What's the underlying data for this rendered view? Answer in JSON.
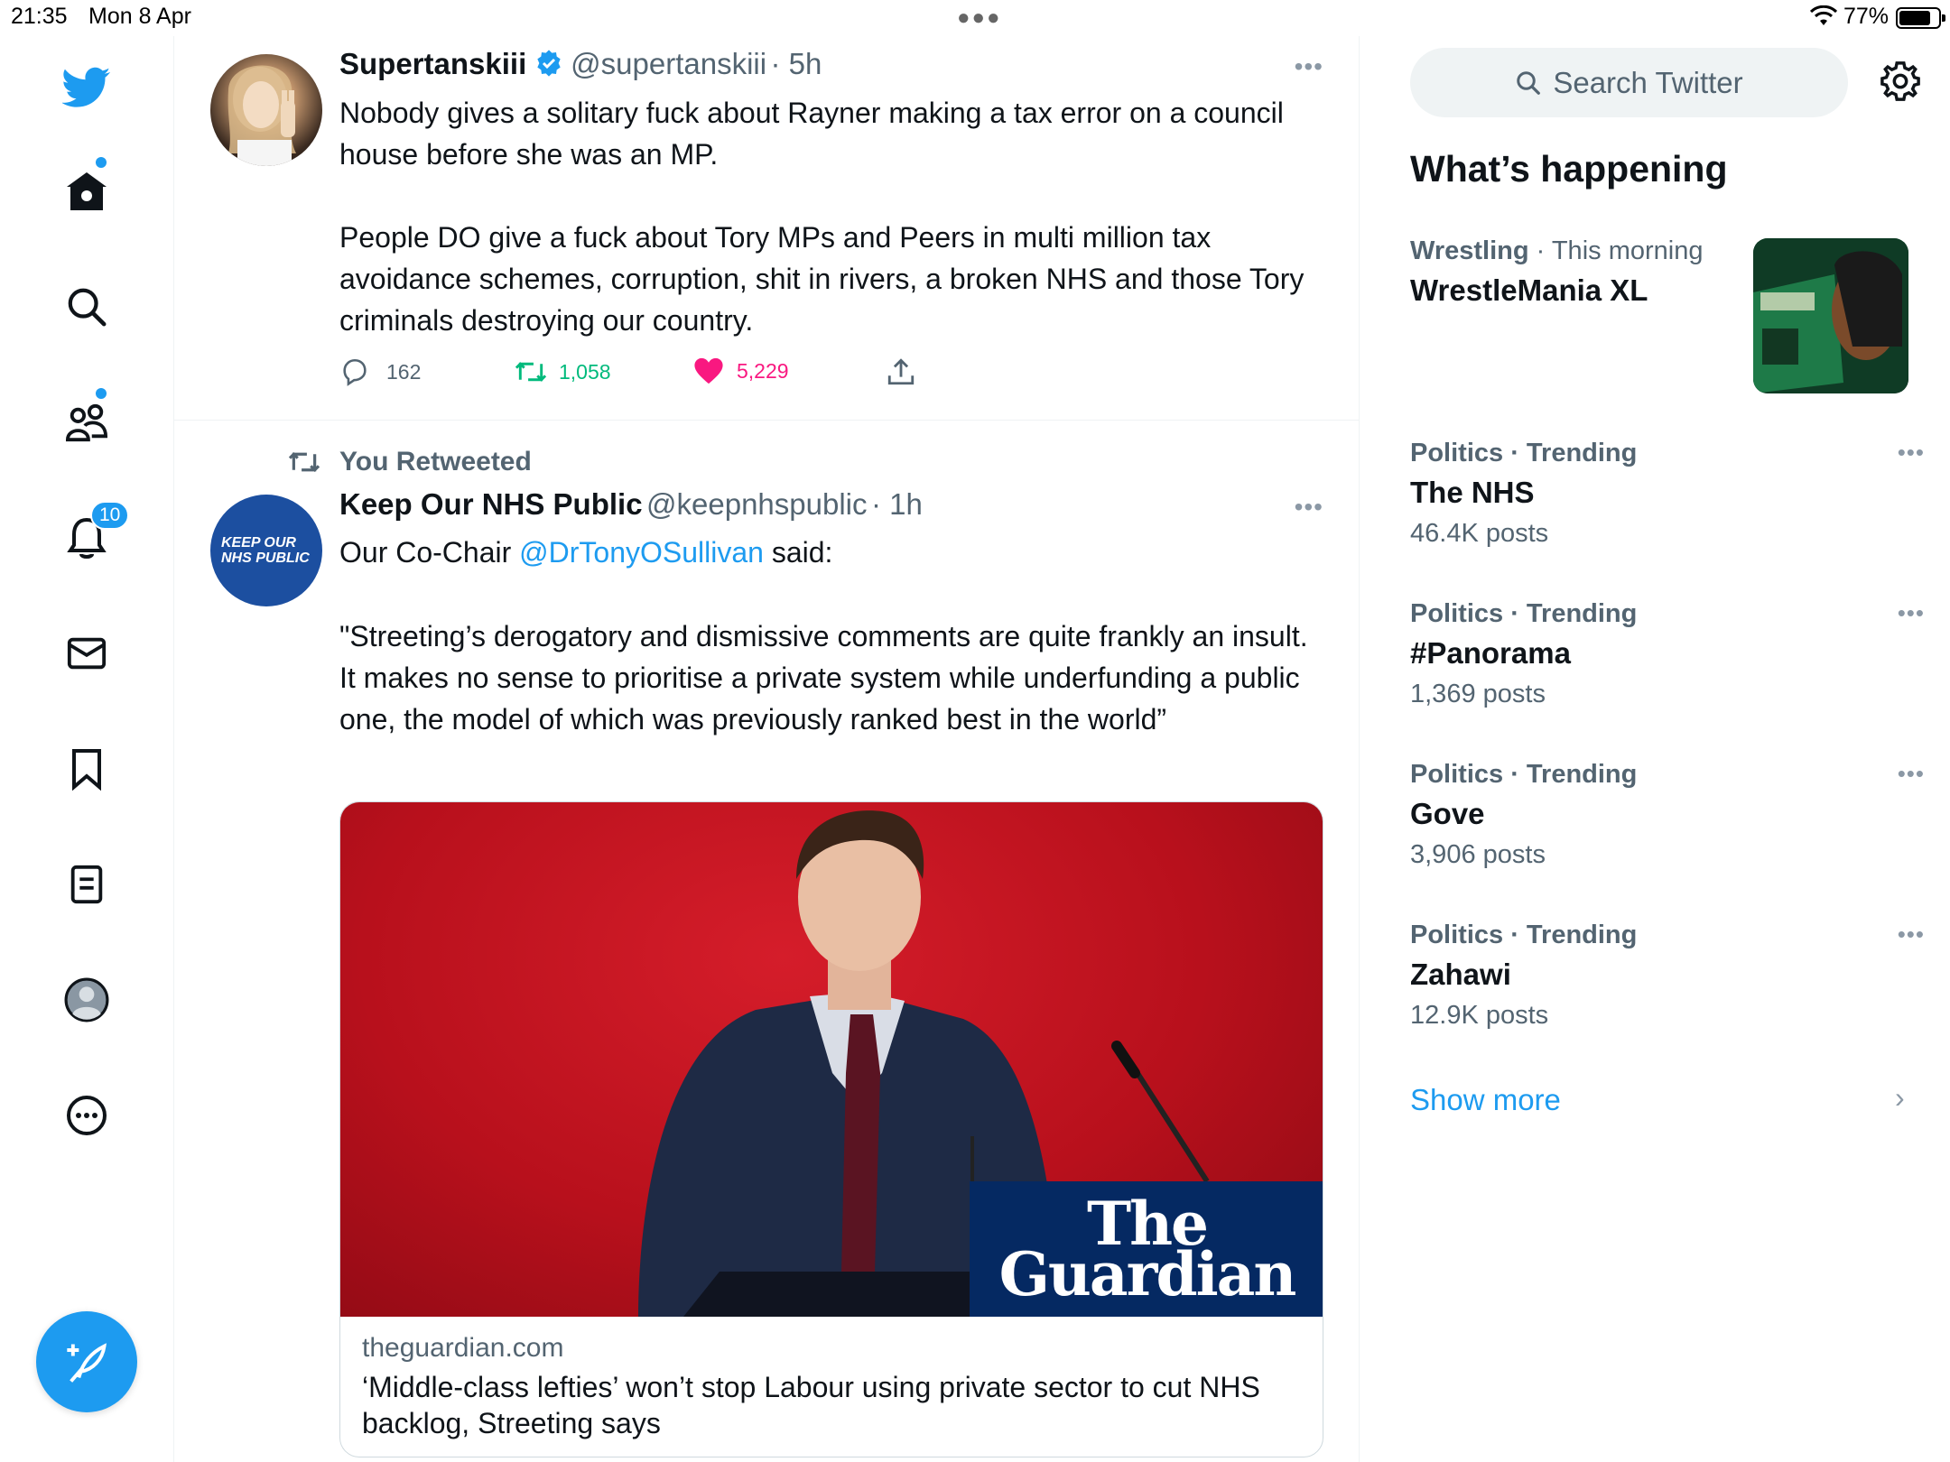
{
  "status_bar": {
    "time": "21:35",
    "date": "Mon 8 Apr",
    "battery": "77%",
    "battery_level": 0.77
  },
  "nav": {
    "icons": [
      "twitter-logo-icon",
      "home-icon",
      "search-icon",
      "communities-icon",
      "notifications-icon",
      "messages-icon",
      "bookmarks-icon",
      "lists-icon",
      "profile-icon",
      "more-icon"
    ],
    "notifications_badge": "10",
    "compose_icon": "compose-tweet-icon"
  },
  "timeline": {
    "tweet1": {
      "name": "Supertanskiii",
      "handle": "@supertanskiii",
      "time": "· 5h",
      "verified": true,
      "text": "Nobody gives a solitary fuck about Rayner making a tax error on a council house before she was an MP.\n\nPeople DO give a fuck about Tory MPs and Peers in multi million tax avoidance schemes, corruption, shit in rivers, a broken NHS and those Tory criminals destroying our country.",
      "replies": "162",
      "retweets": "1,058",
      "likes": "5,229"
    },
    "tweet2": {
      "retweet_label": "You Retweeted",
      "name": "Keep Our NHS Public",
      "handle": "@keepnhspublic",
      "time": "· 1h",
      "avatar_text_line1": "KEEP OUR",
      "avatar_text_line2": "NHS PUBLIC",
      "text_prefix": "Our Co-Chair ",
      "mention": "@DrTonyOSullivan",
      "text_suffix": " said:",
      "quote": "\"Streeting’s derogatory and dismissive comments are quite frankly an insult. It makes no sense to prioritise a private system while underfunding a public one, the model of which was previously ranked best in the world”",
      "card": {
        "brand_line1": "The",
        "brand_line2": "Guardian",
        "domain": "theguardian.com",
        "title": "‘Middle-class lefties’ won’t stop Labour using private sector to cut NHS backlog, Streeting says"
      }
    }
  },
  "sidebar": {
    "search_placeholder": "Search Twitter",
    "section_title": "What’s happening",
    "trends": [
      {
        "category": "Wrestling",
        "context": "· This morning",
        "name": "WrestleMania XL",
        "count": ""
      },
      {
        "category": "Politics · Trending",
        "context": "",
        "name": "The NHS",
        "count": "46.4K posts"
      },
      {
        "category": "Politics · Trending",
        "context": "",
        "name": "#Panorama",
        "count": "1,369 posts"
      },
      {
        "category": "Politics · Trending",
        "context": "",
        "name": "Gove",
        "count": "3,906 posts"
      },
      {
        "category": "Politics · Trending",
        "context": "",
        "name": "Zahawi",
        "count": "12.9K posts"
      }
    ],
    "show_more": "Show more"
  },
  "colors": {
    "accent": "#1d9bf0",
    "retweet_green": "#00ba7c",
    "like_pink": "#f91880",
    "guardian_blue": "#052962"
  }
}
